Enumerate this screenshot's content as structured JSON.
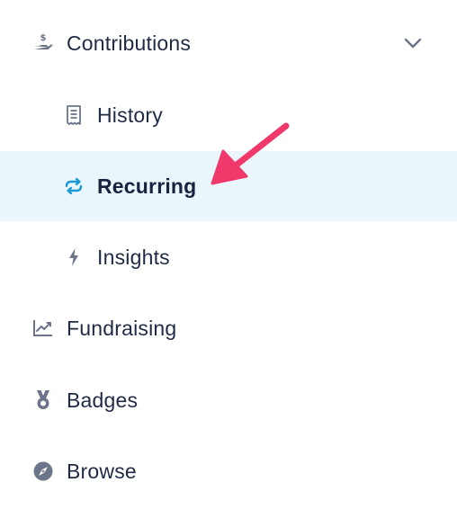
{
  "nav": {
    "contributions": {
      "label": "Contributions",
      "icon": "hand-dollar-icon",
      "expanded": true,
      "children": [
        {
          "label": "History",
          "icon": "receipt-icon"
        },
        {
          "label": "Recurring",
          "icon": "recurring-arrows-icon",
          "active": true
        },
        {
          "label": "Insights",
          "icon": "lightning-icon"
        }
      ]
    },
    "items": [
      {
        "label": "Fundraising",
        "icon": "line-chart-icon"
      },
      {
        "label": "Badges",
        "icon": "medal-icon"
      },
      {
        "label": "Browse",
        "icon": "compass-icon"
      }
    ]
  },
  "colors": {
    "active_background": "#eaf6fc",
    "active_icon": "#1a9ad6",
    "icon_gray": "#6b7489",
    "text": "#1f2a44",
    "annotation_arrow": "#f0386b"
  }
}
